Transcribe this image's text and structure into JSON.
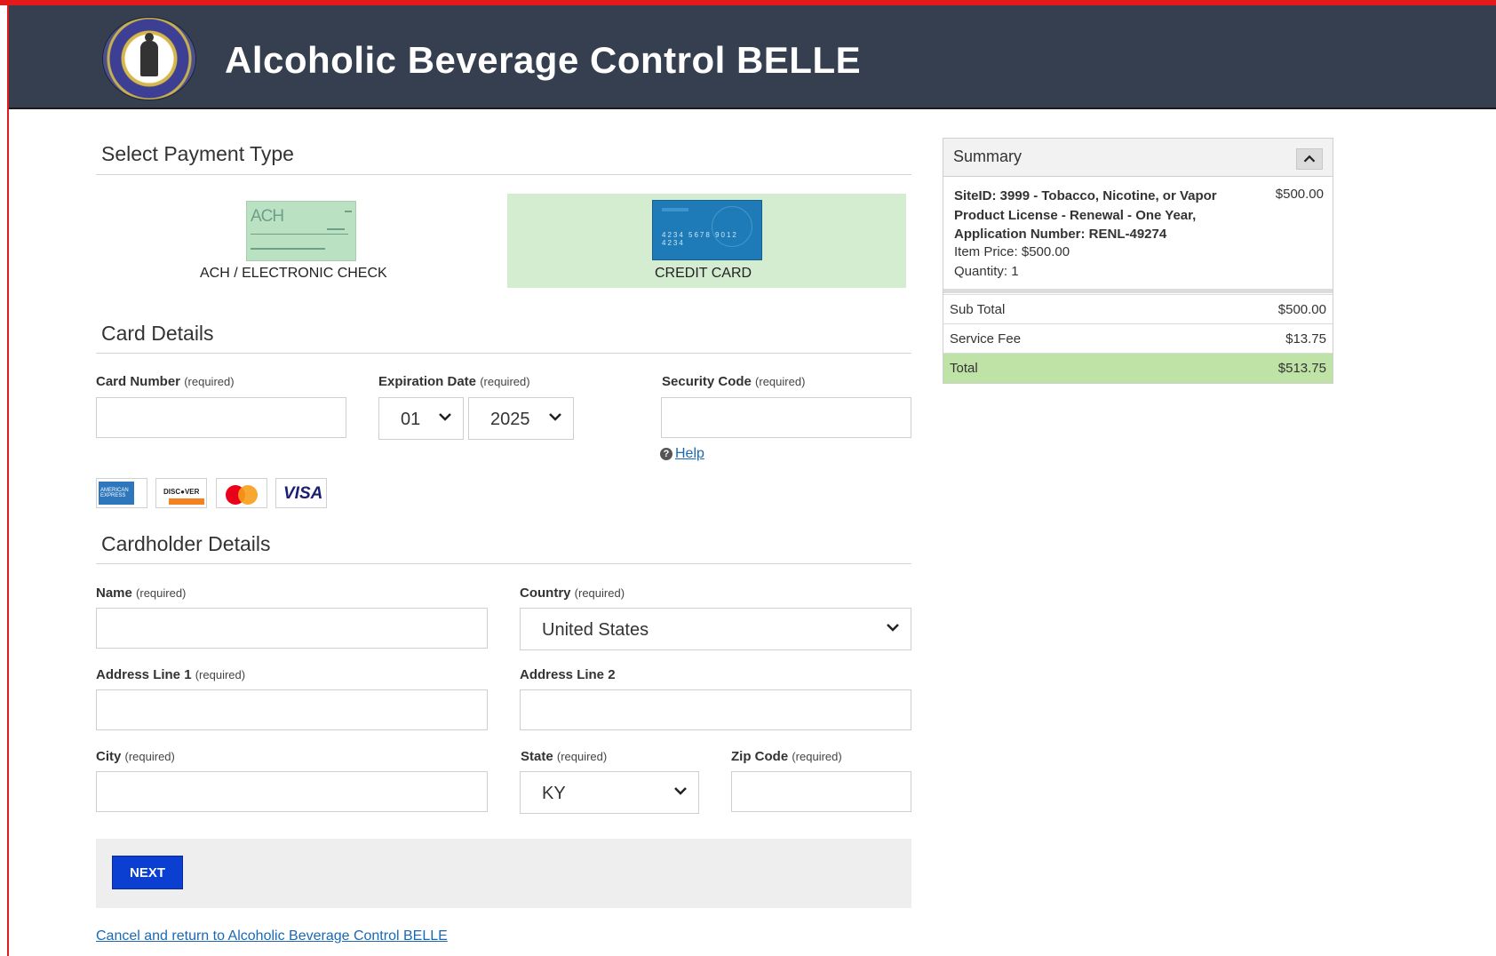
{
  "header": {
    "app_title": "Alcoholic Beverage Control BELLE",
    "seal_icon": "kentucky-seal-icon"
  },
  "payment_type": {
    "title": "Select Payment Type",
    "options": [
      {
        "label": "ACH / ELECTRONIC CHECK",
        "icon": "ach-check-icon",
        "selected": false
      },
      {
        "label": "CREDIT CARD",
        "icon": "credit-card-icon",
        "selected": true
      }
    ],
    "selected_color": "#d4edd0"
  },
  "card_details": {
    "title": "Card Details",
    "card_number": {
      "label": "Card Number",
      "required": "(required)",
      "value": ""
    },
    "expiration": {
      "label": "Expiration Date",
      "required": "(required)",
      "month": "01",
      "year": "2025"
    },
    "security_code": {
      "label": "Security Code",
      "required": "(required)",
      "value": ""
    },
    "help_link": "Help",
    "accepted_cards": [
      "american-express-icon",
      "discover-icon",
      "mastercard-icon",
      "visa-icon"
    ]
  },
  "cardholder": {
    "title": "Cardholder Details",
    "name": {
      "label": "Name",
      "required": "(required)",
      "value": ""
    },
    "country": {
      "label": "Country",
      "required": "(required)",
      "value": "United States"
    },
    "address1": {
      "label": "Address Line 1",
      "required": "(required)",
      "value": ""
    },
    "address2": {
      "label": "Address Line 2",
      "value": ""
    },
    "city": {
      "label": "City",
      "required": "(required)",
      "value": ""
    },
    "state": {
      "label": "State",
      "required": "(required)",
      "value": "KY"
    },
    "zip": {
      "label": "Zip Code",
      "required": "(required)",
      "value": ""
    }
  },
  "actions": {
    "next_label": "NEXT",
    "next_color": "#0a3fd1",
    "cancel_link": "Cancel and return to Alcoholic Beverage Control BELLE"
  },
  "summary": {
    "title": "Summary",
    "item_description": "SiteID: 3999 - Tobacco, Nicotine, or Vapor Product License - Renewal - One Year, Application Number: RENL-49274",
    "item_amount": "$500.00",
    "item_price": "Item Price: $500.00",
    "quantity": "Quantity: 1",
    "subtotal_label": "Sub Total",
    "subtotal": "$500.00",
    "fee_label": "Service Fee",
    "fee": "$13.75",
    "total_label": "Total",
    "total": "$513.75",
    "total_color": "#bfe2a7"
  },
  "colors": {
    "header_bg": "#353f4f",
    "frame_accent": "#e21a1a",
    "link": "#1b69b5"
  }
}
